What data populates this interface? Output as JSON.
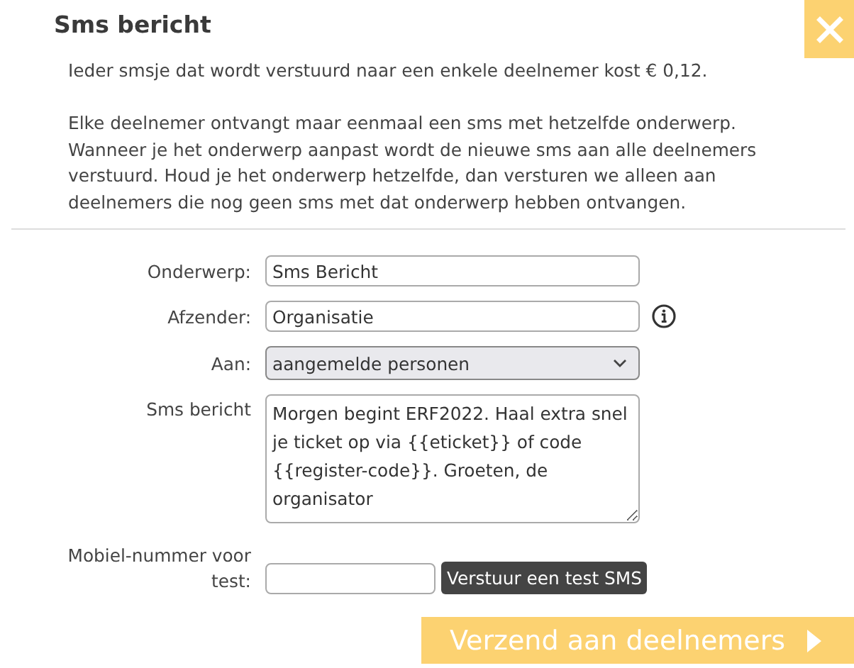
{
  "dialog": {
    "title": "Sms bericht"
  },
  "intro": [
    "Ieder smsje dat wordt verstuurd naar een enkele deelnemer kost € 0,12.",
    "Elke deelnemer ontvangt maar eenmaal een sms met hetzelfde onderwerp. Wanneer je het onderwerp aanpast wordt de nieuwe sms aan alle deelnemers verstuurd. Houd je het onderwerp hetzelfde, dan versturen we alleen aan deelnemers die nog geen sms met dat onderwerp hebben ontvangen."
  ],
  "fields": [
    {
      "kind": "text",
      "label": "Onderwerp:",
      "value": "Sms Bericht",
      "info": false
    },
    {
      "kind": "text",
      "label": "Afzender:",
      "value": "Organisatie",
      "info": true
    },
    {
      "kind": "select",
      "label": "Aan:",
      "value": "aangemelde personen",
      "info": false
    },
    {
      "kind": "textarea",
      "label": "Sms bericht",
      "value": "Morgen begint ERF2022. Haal extra snel je ticket op via {{eticket}} of code {{register-code}}. Groeten, de organisator",
      "info": false
    }
  ],
  "test": {
    "label": "Mobiel-nummer voor test:",
    "button": "Verstuur een test SMS"
  },
  "submit": "Verzend aan deelnemers"
}
